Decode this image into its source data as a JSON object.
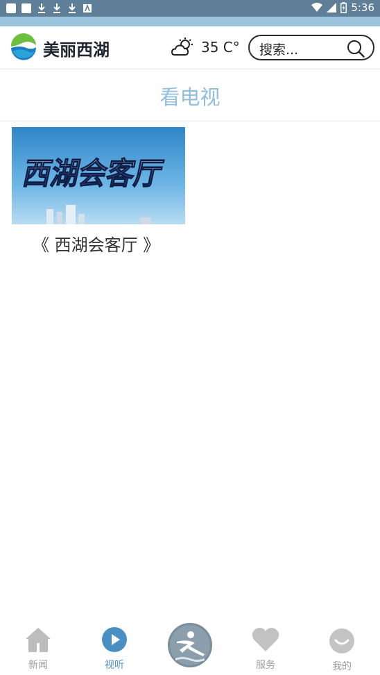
{
  "status_bar": {
    "time": "5:36"
  },
  "header": {
    "brand": "美丽西湖",
    "temperature": "35 C°",
    "search_label": "搜索...",
    "weather_icon": "partly-cloudy-sun-icon"
  },
  "page": {
    "title": "看电视"
  },
  "programs": [
    {
      "thumbnail_text": "西湖会客厅",
      "title": "《 西湖会客厅 》"
    }
  ],
  "bottom_nav": {
    "items": [
      {
        "label": "新闻",
        "icon": "home-icon",
        "active": false
      },
      {
        "label": "视听",
        "icon": "play-icon",
        "active": true
      },
      {
        "label": "",
        "icon": "xihu-emblem-icon",
        "active": false
      },
      {
        "label": "服务",
        "icon": "heart-icon",
        "active": false
      },
      {
        "label": "我的",
        "icon": "smiley-icon",
        "active": false
      }
    ]
  },
  "colors": {
    "status_bar": "#5f7f98",
    "accent": "#9cc4de",
    "title": "#8fbfdc",
    "active_nav": "#4a8fc4",
    "inactive_nav": "#b5b5b5"
  }
}
